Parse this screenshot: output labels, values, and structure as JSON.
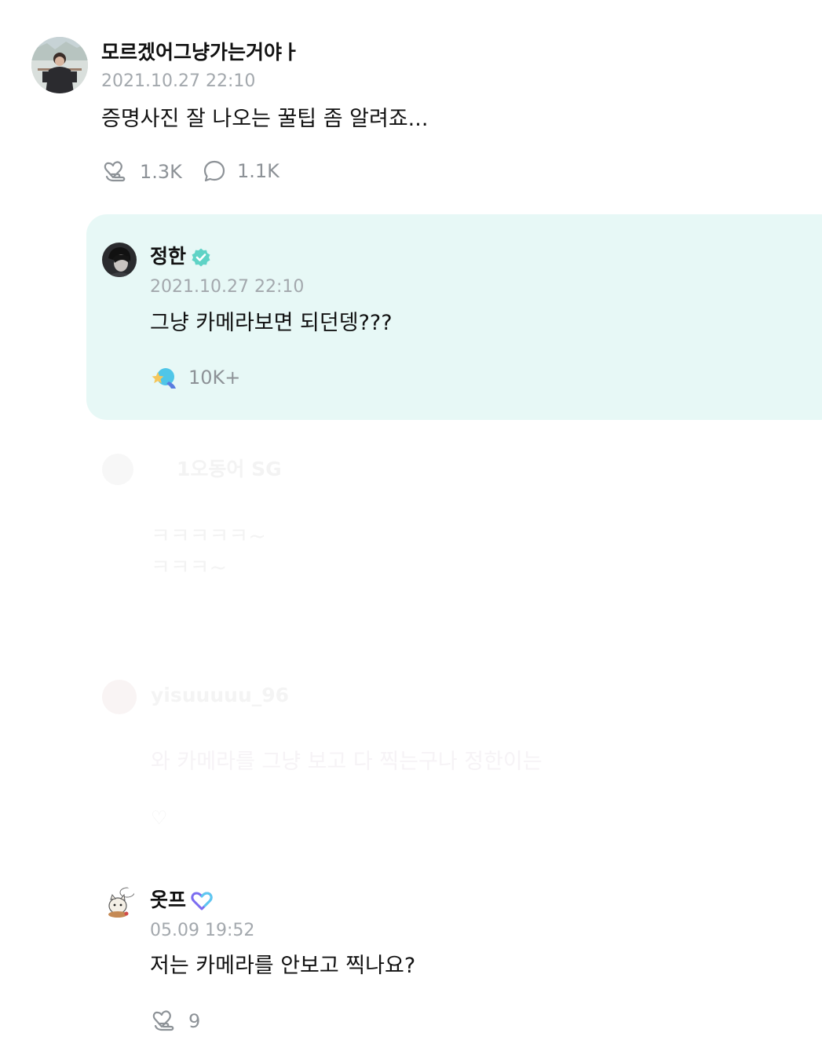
{
  "post": {
    "author": "모르겠어그냥가는거야ㅏ",
    "timestamp": "2021.10.27 22:10",
    "text": "증명사진 잘 나오는 꿀팁 좀 알려죠...",
    "like_count": "1.3K",
    "comment_count": "1.1K"
  },
  "artist_reply": {
    "author": "정한",
    "timestamp": "2021.10.27 22:10",
    "text": "그냥 카메라보면 되던뎅???",
    "like_count": "10K+"
  },
  "faded_comment_1": {
    "author": "1오동어 SG",
    "line1": "ㅋㅋㅋㅋㅋ~",
    "line2": "ㅋㅋㅋ~"
  },
  "faded_comment_2": {
    "author": "yisuuuuu_96",
    "text": "와 카메라를 그냥 보고 다 찍는구나 정한이는"
  },
  "fan_reply": {
    "author": "옷프",
    "timestamp": "05.09 19:52",
    "text": "저는 카메라를 안보고 찍나요?",
    "like_count": "9"
  },
  "colors": {
    "artist_card_bg": "#e7f8f6",
    "verified_badge": "#5fd3c6",
    "membership_heart": "#7b6cf0",
    "muted_text": "#a3a8ad"
  },
  "icons": {
    "like": "heart-hand-icon",
    "comment": "speech-bubble-icon",
    "artist_like": "colored-like-icon",
    "verified": "verified-badge-icon",
    "membership": "membership-heart-icon"
  }
}
